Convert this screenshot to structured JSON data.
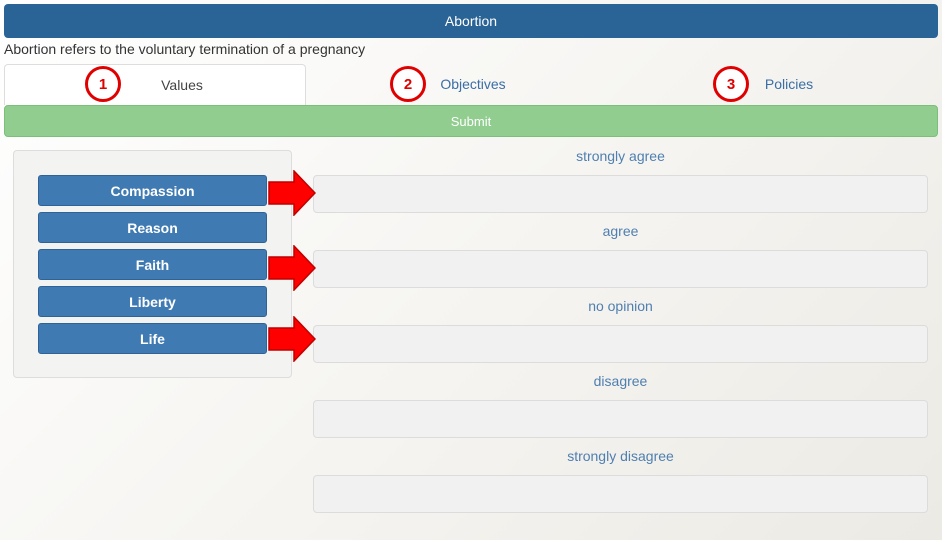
{
  "header": {
    "title": "Abortion"
  },
  "description": "Abortion refers to the voluntary termination of a pregnancy",
  "tabs": [
    {
      "label": "Values",
      "marker": "1",
      "active": true
    },
    {
      "label": "Objectives",
      "marker": "2",
      "active": false
    },
    {
      "label": "Policies",
      "marker": "3",
      "active": false
    }
  ],
  "submit_label": "Submit",
  "values": [
    "Compassion",
    "Reason",
    "Faith",
    "Liberty",
    "Life"
  ],
  "zones": [
    "strongly agree",
    "agree",
    "no opinion",
    "disagree",
    "strongly disagree"
  ],
  "colors": {
    "header": "#2a6496",
    "submit": "#90cd8f",
    "value_button": "#3f7ab3",
    "annotation": "#e00000"
  }
}
